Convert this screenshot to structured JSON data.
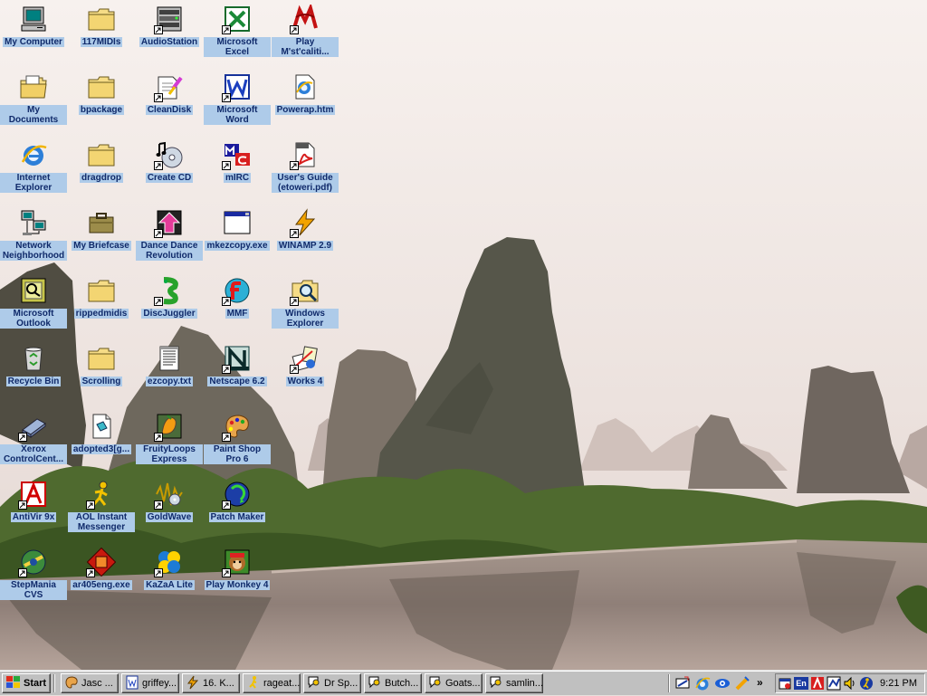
{
  "desktop": {
    "icons": [
      {
        "id": "my-computer",
        "label": "My Computer",
        "icon": "computer-icon",
        "shortcut": false
      },
      {
        "id": "my-documents",
        "label": "My Documents",
        "icon": "documents-folder-icon",
        "shortcut": false
      },
      {
        "id": "internet-explorer",
        "label": "Internet Explorer",
        "icon": "internet-explorer-icon",
        "shortcut": false
      },
      {
        "id": "network-neighborhood",
        "label": "Network Neighborhood",
        "icon": "network-icon",
        "shortcut": false
      },
      {
        "id": "microsoft-outlook",
        "label": "Microsoft Outlook",
        "icon": "outlook-icon",
        "shortcut": false
      },
      {
        "id": "recycle-bin",
        "label": "Recycle Bin",
        "icon": "recycle-bin-icon",
        "shortcut": false
      },
      {
        "id": "xerox-controlcentre",
        "label": "Xerox ControlCent...",
        "icon": "xerox-scanner-icon",
        "shortcut": true
      },
      {
        "id": "antivir",
        "label": "AntiVir 9x",
        "icon": "antivir-icon",
        "shortcut": true
      },
      {
        "id": "stepmania",
        "label": "StepMania CVS",
        "icon": "stepmania-icon",
        "shortcut": true
      },
      {
        "id": "117midis",
        "label": "117MIDIs",
        "icon": "folder-icon",
        "shortcut": false
      },
      {
        "id": "bpackage",
        "label": "bpackage",
        "icon": "folder-icon",
        "shortcut": false
      },
      {
        "id": "dragdrop",
        "label": "dragdrop",
        "icon": "folder-icon",
        "shortcut": false
      },
      {
        "id": "my-briefcase",
        "label": "My Briefcase",
        "icon": "briefcase-icon",
        "shortcut": false
      },
      {
        "id": "rippedmidis",
        "label": "rippedmidis",
        "icon": "folder-icon",
        "shortcut": false
      },
      {
        "id": "scrolling",
        "label": "Scrolling",
        "icon": "folder-icon",
        "shortcut": false
      },
      {
        "id": "adopted3",
        "label": "adopted3[g...",
        "icon": "document-icon",
        "shortcut": false
      },
      {
        "id": "aol-instant-messenger",
        "label": "AOL Instant Messenger",
        "icon": "aim-runner-icon",
        "shortcut": true
      },
      {
        "id": "ar405eng",
        "label": "ar405eng.exe",
        "icon": "installer-icon",
        "shortcut": true
      },
      {
        "id": "audiostation",
        "label": "AudioStation",
        "icon": "audio-rack-icon",
        "shortcut": true
      },
      {
        "id": "cleandisk",
        "label": "CleanDisk",
        "icon": "cleandisk-icon",
        "shortcut": true
      },
      {
        "id": "create-cd",
        "label": "Create CD",
        "icon": "create-cd-icon",
        "shortcut": true
      },
      {
        "id": "dance-dance-revolution",
        "label": "Dance Dance Revolution",
        "icon": "ddr-arrow-icon",
        "shortcut": true
      },
      {
        "id": "discjuggler",
        "label": "DiscJuggler",
        "icon": "discjuggler-icon",
        "shortcut": true
      },
      {
        "id": "ezcopy",
        "label": "ezcopy.txt",
        "icon": "text-file-icon",
        "shortcut": false
      },
      {
        "id": "fruityloops",
        "label": "FruityLoops Express",
        "icon": "fruityloops-icon",
        "shortcut": true
      },
      {
        "id": "goldwave",
        "label": "GoldWave",
        "icon": "goldwave-icon",
        "shortcut": true
      },
      {
        "id": "kazaa-lite",
        "label": "KaZaA Lite",
        "icon": "kazaa-icon",
        "shortcut": true
      },
      {
        "id": "microsoft-excel",
        "label": "Microsoft Excel",
        "icon": "excel-icon",
        "shortcut": true
      },
      {
        "id": "microsoft-word",
        "label": "Microsoft Word",
        "icon": "word-icon",
        "shortcut": true
      },
      {
        "id": "mirc",
        "label": "mIRC",
        "icon": "mirc-icon",
        "shortcut": true
      },
      {
        "id": "mkezcopy",
        "label": "mkezcopy.exe",
        "icon": "exe-window-icon",
        "shortcut": false
      },
      {
        "id": "mmf",
        "label": "MMF",
        "icon": "mmf-icon",
        "shortcut": true
      },
      {
        "id": "netscape",
        "label": "Netscape 6.2",
        "icon": "netscape-icon",
        "shortcut": true
      },
      {
        "id": "paint-shop-pro",
        "label": "Paint Shop Pro 6",
        "icon": "paint-palette-icon",
        "shortcut": true
      },
      {
        "id": "patch-maker",
        "label": "Patch Maker",
        "icon": "patch-maker-icon",
        "shortcut": true
      },
      {
        "id": "play-monkey",
        "label": "Play Monkey 4",
        "icon": "monkey-game-icon",
        "shortcut": true
      },
      {
        "id": "play-mstcalities",
        "label": "Play M'st'caliti...",
        "icon": "play-game-icon",
        "shortcut": true
      },
      {
        "id": "powerap",
        "label": "Powerap.htm",
        "icon": "html-file-icon",
        "shortcut": false
      },
      {
        "id": "users-guide",
        "label": "User's Guide (etoweri.pdf)",
        "icon": "pdf-icon",
        "shortcut": true
      },
      {
        "id": "winamp",
        "label": "WINAMP 2.9",
        "icon": "winamp-icon",
        "shortcut": true
      },
      {
        "id": "windows-explorer",
        "label": "Windows Explorer",
        "icon": "explorer-icon",
        "shortcut": true
      },
      {
        "id": "works",
        "label": "Works 4",
        "icon": "works-icon",
        "shortcut": true
      }
    ]
  },
  "taskbar": {
    "start_label": "Start",
    "quick_launch": [
      "show-desktop-icon",
      "internet-explorer-icon",
      "outlook-express-icon",
      "channels-icon"
    ],
    "tasks": [
      {
        "label": "Jasc ...",
        "icon": "jasc-icon"
      },
      {
        "label": "griffey...",
        "icon": "word-doc-icon"
      },
      {
        "label": "16. K...",
        "icon": "winamp-icon"
      },
      {
        "label": "rageat...",
        "icon": "aim-runner-icon"
      },
      {
        "label": "Dr Sp...",
        "icon": "aim-chat-icon"
      },
      {
        "label": "Butch...",
        "icon": "aim-chat-icon"
      },
      {
        "label": "Goats...",
        "icon": "aim-chat-icon"
      },
      {
        "label": "samlin...",
        "icon": "aim-chat-icon"
      }
    ],
    "more_label": "»",
    "tray": {
      "icons": [
        "scheduler-icon",
        "language-indicator-icon",
        "antivir-tray-icon",
        "network-tray-icon",
        "volume-icon",
        "aim-tray-icon"
      ],
      "language_label": "En",
      "clock": "9:21 PM"
    }
  }
}
